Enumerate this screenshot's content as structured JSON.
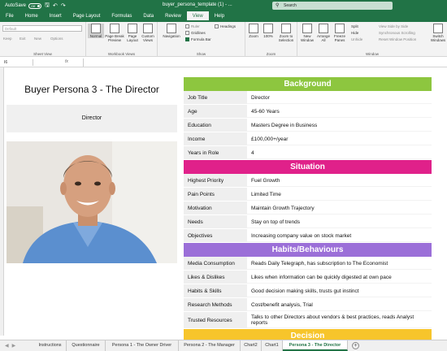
{
  "titlebar": {
    "autosave": "AutoSave",
    "autosave_state": "Off",
    "doc_title": "buyer_persona_template (1) - ...",
    "search": "Search"
  },
  "menu_tabs": [
    "File",
    "Home",
    "Insert",
    "Page Layout",
    "Formulas",
    "Data",
    "Review",
    "View",
    "Help"
  ],
  "active_tab": "View",
  "ribbon": {
    "sheet_view": {
      "dropdown": "Default",
      "keep": "Keep",
      "exit": "Exit",
      "new": "New",
      "options": "Options",
      "label": "Sheet View"
    },
    "workbook_views": {
      "normal": "Normal",
      "page_break": "Page Break Preview",
      "page_layout": "Page Layout",
      "custom": "Custom Views",
      "label": "Workbook Views"
    },
    "show": {
      "navigation": "Navigation",
      "ruler": "Ruler",
      "gridlines": "Gridlines",
      "formula_bar": "Formula Bar",
      "headings": "Headings",
      "label": "Show"
    },
    "zoom": {
      "zoom": "Zoom",
      "hundred": "100%",
      "zoom_sel": "Zoom to Selection",
      "label": "Zoom"
    },
    "window": {
      "new_window": "New Window",
      "arrange": "Arrange All",
      "freeze": "Freeze Panes",
      "split": "Split",
      "hide": "Hide",
      "unhide": "Unhide",
      "side": "View Side by Side",
      "sync": "Synchronous Scrolling",
      "reset": "Reset Window Position",
      "switch": "Switch Windows",
      "label": "Window"
    }
  },
  "formula_bar": {
    "name_box": "I6",
    "fx": "fx",
    "value": ""
  },
  "persona": {
    "title": "Buyer Persona 3 - The Director",
    "role": "Director"
  },
  "colors": {
    "background": "#8dc63f",
    "situation": "#e0218a",
    "habits": "#9b6fd8",
    "decision": "#f7c52b"
  },
  "sections": [
    {
      "title": "Background",
      "rows": [
        {
          "k": "Job Title",
          "v": "Director"
        },
        {
          "k": "Age",
          "v": "45-60 Years"
        },
        {
          "k": "Education",
          "v": "Masters Degree in Business"
        },
        {
          "k": "Income",
          "v": "£100,000+/year"
        },
        {
          "k": "Years in Role",
          "v": "4"
        }
      ]
    },
    {
      "title": "Situation",
      "rows": [
        {
          "k": "Highest Priority",
          "v": "Fuel Growth"
        },
        {
          "k": "Pain Points",
          "v": "Limited Time"
        },
        {
          "k": "Motivation",
          "v": "Maintain Growth Trajectory"
        },
        {
          "k": "Needs",
          "v": "Stay on top of trends"
        },
        {
          "k": "Objectives",
          "v": "Increasing company value on stock market"
        }
      ]
    },
    {
      "title": "Habits/Behaviours",
      "rows": [
        {
          "k": "Media Consumption",
          "v": "Reads Daily Telegraph, has subscription to The Economist"
        },
        {
          "k": "Likes & Dislikes",
          "v": "Likes when information can be quickly digested at own pace"
        },
        {
          "k": "Habits & Skills",
          "v": "Good decision making skills, trusts gut instinct"
        },
        {
          "k": "Research Methods",
          "v": "Cost/benefit analysis, Trial"
        },
        {
          "k": "Trusted Resources",
          "v": "Talks to other Directors about vendors & best practices, reads Analyst reports"
        }
      ]
    },
    {
      "title": "Decision",
      "rows": []
    }
  ],
  "sheet_tabs": [
    "Instructions",
    "Questionnaire",
    "Persona 1 -  The Owner Driver",
    "Persona 2 - The Manager",
    "Chart2",
    "Chart1",
    "Persona 3 - The Director"
  ],
  "active_sheet": "Persona 3 - The Director"
}
